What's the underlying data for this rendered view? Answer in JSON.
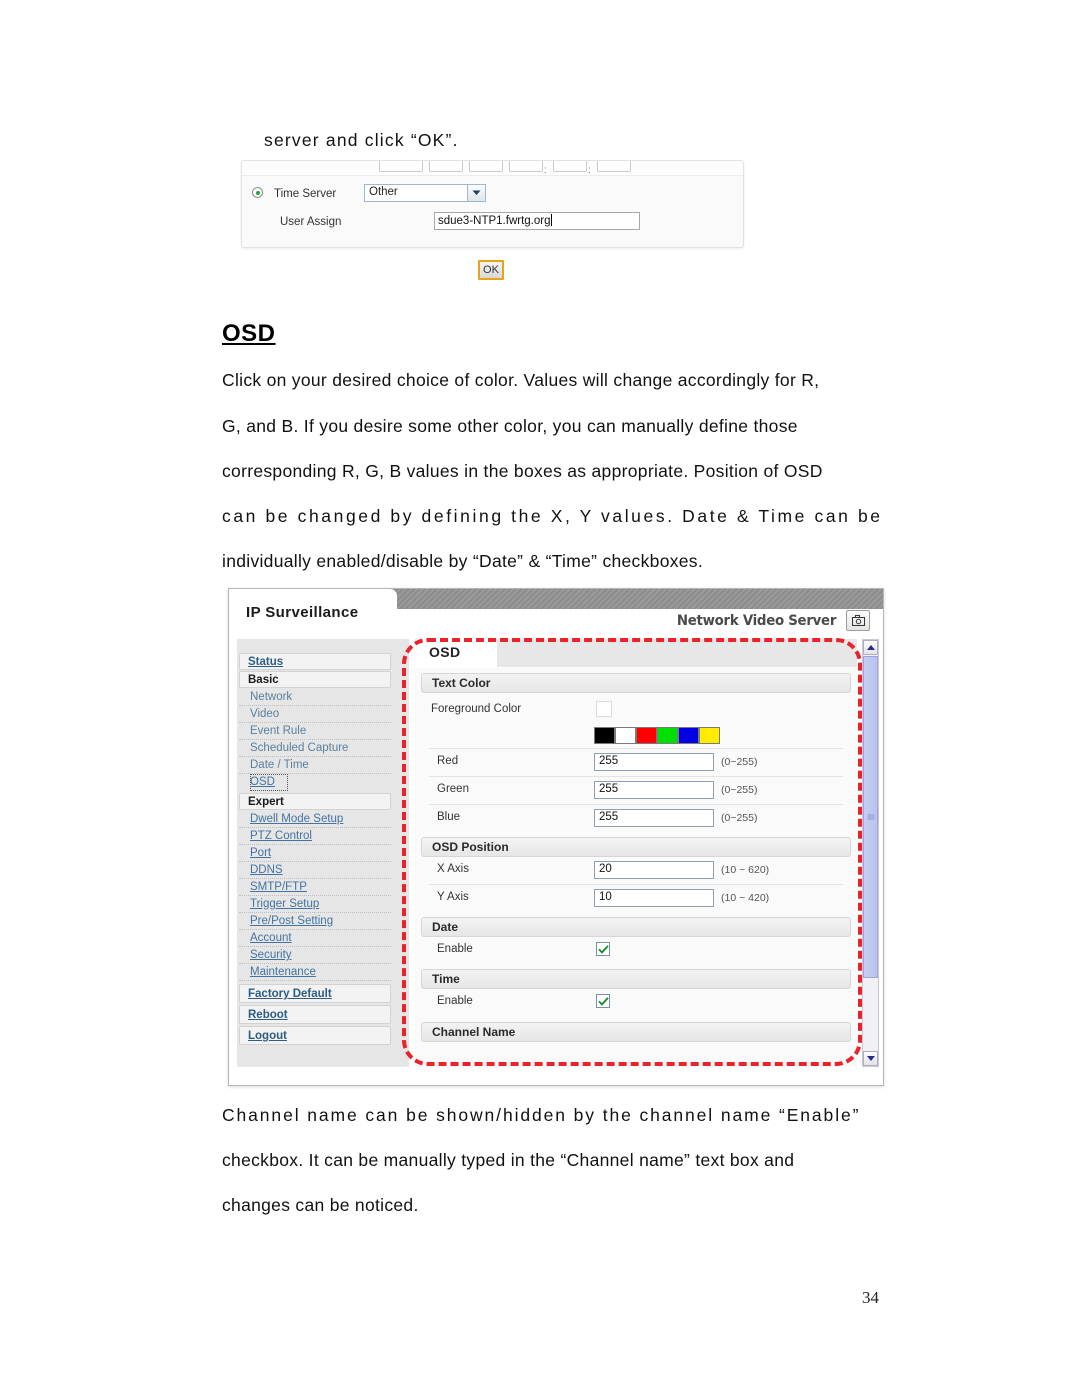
{
  "document": {
    "page_number": "34",
    "intro_line": "server and click “OK”.",
    "heading": "OSD",
    "paragraph1_lines": [
      "Click on your desired choice of color. Values will change accordingly for R,",
      "G, and B. If you desire some other color, you can manually define those",
      "corresponding R, G, B values in the boxes as appropriate. Position of OSD",
      "can be changed by defining the X, Y values. Date & Time can be",
      "individually enabled/disable by “Date” & “Time” checkboxes."
    ],
    "paragraph2_lines": [
      "Channel name can be shown/hidden by the channel name “Enable”",
      "checkbox. It can be manually typed in the “Channel name” text box and",
      "changes can be noticed."
    ]
  },
  "time_server_shot": {
    "time_server_label": "Time Server",
    "time_server_value": "Other",
    "user_assign_label": "User Assign",
    "user_assign_value": "sdue3-NTP1.fwrtg.org",
    "ok_label": "OK"
  },
  "app": {
    "brand": "IP Surveillance",
    "product": "Network Video Server",
    "camera_icon": "camera-icon"
  },
  "sidebar": {
    "items": [
      {
        "label": "Status",
        "type": "section-link"
      },
      {
        "label": "Basic",
        "type": "section"
      },
      {
        "label": "Network",
        "type": "item"
      },
      {
        "label": "Video",
        "type": "item"
      },
      {
        "label": "Event Rule",
        "type": "item"
      },
      {
        "label": "Scheduled Capture",
        "type": "item"
      },
      {
        "label": "Date / Time",
        "type": "item"
      },
      {
        "label": "OSD",
        "type": "item-selected"
      },
      {
        "label": "Expert",
        "type": "section"
      },
      {
        "label": "Dwell Mode Setup",
        "type": "item"
      },
      {
        "label": "PTZ Control",
        "type": "item"
      },
      {
        "label": "Port",
        "type": "item"
      },
      {
        "label": "DDNS",
        "type": "item"
      },
      {
        "label": "SMTP/FTP",
        "type": "item"
      },
      {
        "label": "Trigger Setup",
        "type": "item"
      },
      {
        "label": "Pre/Post Setting",
        "type": "item"
      },
      {
        "label": "Account",
        "type": "item"
      },
      {
        "label": "Security",
        "type": "item"
      },
      {
        "label": "Maintenance",
        "type": "item"
      },
      {
        "label": "Factory Default",
        "type": "section-link"
      },
      {
        "label": "Reboot",
        "type": "section-link"
      },
      {
        "label": "Logout",
        "type": "section-link"
      }
    ]
  },
  "panel": {
    "tab_label": "OSD",
    "groups": {
      "text_color": {
        "title": "Text Color",
        "foreground_label": "Foreground Color",
        "foreground_value": "#ffffff",
        "swatches": [
          "#000000",
          "#ffffff",
          "#ff0000",
          "#00e000",
          "#0000e6",
          "#ffec00"
        ],
        "channels": [
          {
            "label": "Red",
            "value": "255",
            "hint": "(0~255)"
          },
          {
            "label": "Green",
            "value": "255",
            "hint": "(0~255)"
          },
          {
            "label": "Blue",
            "value": "255",
            "hint": "(0~255)"
          }
        ]
      },
      "osd_position": {
        "title": "OSD Position",
        "axes": [
          {
            "label": "X Axis",
            "value": "20",
            "hint": "(10 ~ 620)"
          },
          {
            "label": "Y Axis",
            "value": "10",
            "hint": "(10 ~ 420)"
          }
        ]
      },
      "date": {
        "title": "Date",
        "enable_label": "Enable",
        "enabled": true
      },
      "time": {
        "title": "Time",
        "enable_label": "Enable",
        "enabled": true
      },
      "channel_name": {
        "title": "Channel Name"
      }
    }
  },
  "annotation": {
    "color": "#e8232a"
  }
}
